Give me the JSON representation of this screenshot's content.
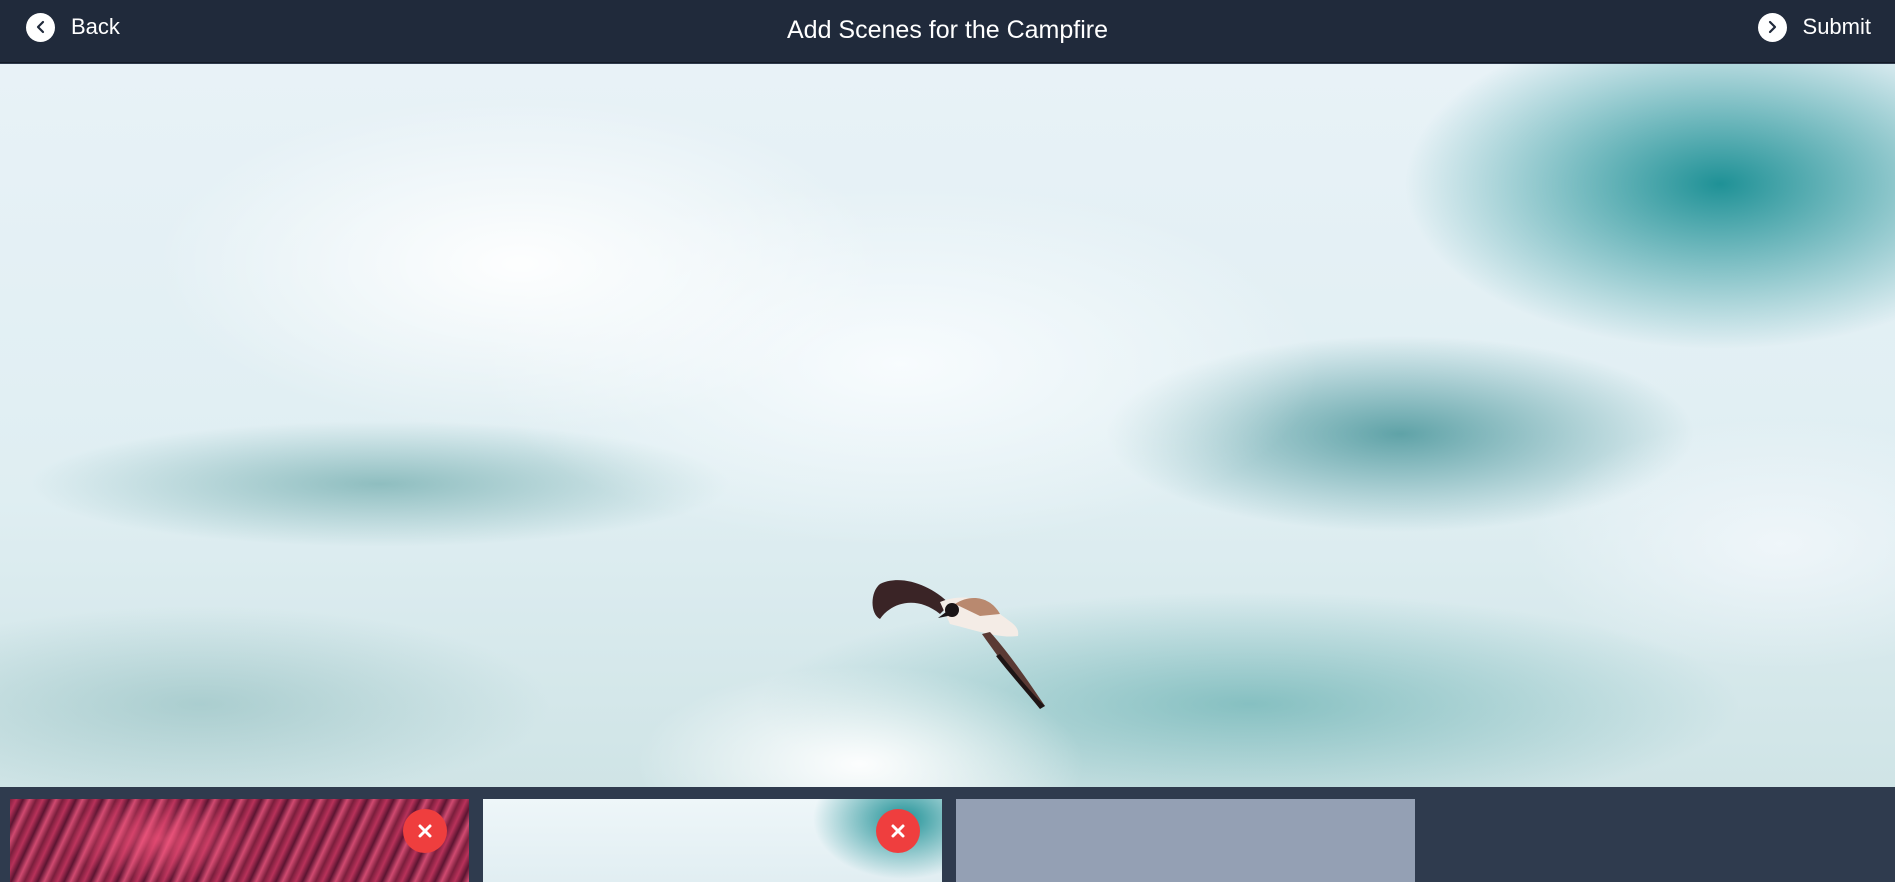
{
  "header": {
    "back_label": "Back",
    "title": "Add Scenes for the Campfire",
    "submit_label": "Submit"
  },
  "preview": {
    "icon": "seagull-photo"
  },
  "thumbnails": [
    {
      "icon": "red-sky-photo",
      "removable": true,
      "remove_icon": "close-icon"
    },
    {
      "icon": "seagull-photo",
      "removable": true,
      "remove_icon": "close-icon"
    },
    {
      "icon": "empty-slot",
      "removable": false
    }
  ],
  "colors": {
    "header_bg": "#202a3b",
    "strip_bg": "#2f3b4e",
    "remove_button": "#ef3e3e",
    "empty_slot": "#94a0b4"
  }
}
